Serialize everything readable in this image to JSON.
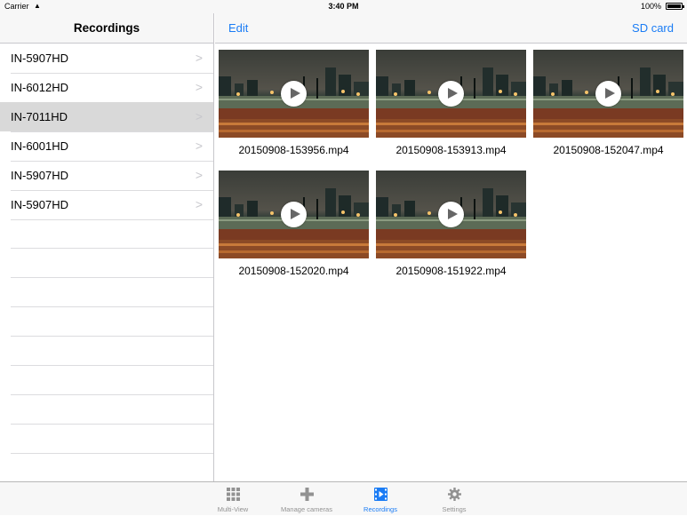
{
  "status_bar": {
    "carrier": "Carrier",
    "time": "3:40 PM",
    "battery": "100%"
  },
  "sidebar": {
    "title": "Recordings",
    "items": [
      {
        "label": "IN-5907HD",
        "selected": false
      },
      {
        "label": "IN-6012HD",
        "selected": false
      },
      {
        "label": "IN-7011HD",
        "selected": true
      },
      {
        "label": "IN-6001HD",
        "selected": false
      },
      {
        "label": "IN-5907HD",
        "selected": false
      },
      {
        "label": "IN-5907HD",
        "selected": false
      }
    ],
    "chevron": ">"
  },
  "navbar": {
    "edit_label": "Edit",
    "sd_label": "SD card"
  },
  "recordings": [
    {
      "filename": "20150908-153956.mp4"
    },
    {
      "filename": "20150908-153913.mp4"
    },
    {
      "filename": "20150908-152047.mp4"
    },
    {
      "filename": "20150908-152020.mp4"
    },
    {
      "filename": "20150908-151922.mp4"
    }
  ],
  "tabs": [
    {
      "label": "Multi-View",
      "icon": "grid-icon",
      "active": false
    },
    {
      "label": "Manage cameras",
      "icon": "plus-icon",
      "active": false
    },
    {
      "label": "Recordings",
      "icon": "film-icon",
      "active": true
    },
    {
      "label": "Settings",
      "icon": "gear-icon",
      "active": false
    }
  ],
  "colors": {
    "accent": "#1a7cf5",
    "selected_row": "#d9d9d9",
    "inactive_tab": "#929292"
  }
}
